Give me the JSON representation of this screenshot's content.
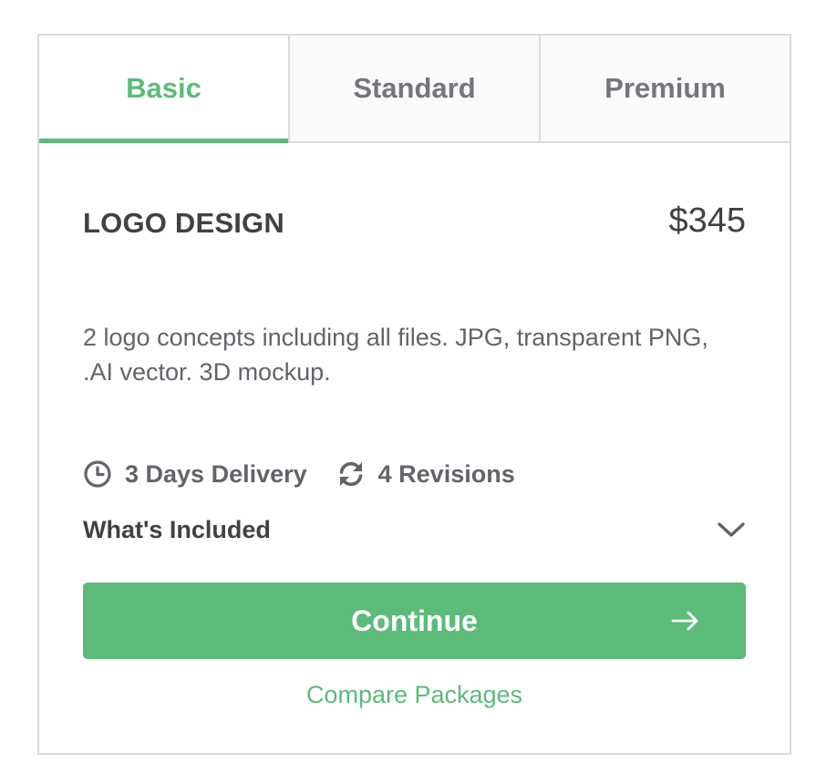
{
  "tabs": [
    {
      "label": "Basic",
      "active": true
    },
    {
      "label": "Standard",
      "active": false
    },
    {
      "label": "Premium",
      "active": false
    }
  ],
  "package": {
    "title": "LOGO DESIGN",
    "price": "$345",
    "description": "2 logo concepts including all files. JPG, transparent PNG, .AI vector. 3D mockup.",
    "delivery": {
      "icon": "clock-icon",
      "label": "3 Days Delivery"
    },
    "revisions": {
      "icon": "refresh-icon",
      "label": "4 Revisions"
    },
    "included_label": "What's Included"
  },
  "actions": {
    "continue_label": "Continue",
    "compare_label": "Compare Packages"
  },
  "colors": {
    "accent": "#5cbb79",
    "text_dark": "#404145",
    "text_muted": "#62646a",
    "tab_inactive": "#74767e",
    "border": "#dadbdd"
  }
}
